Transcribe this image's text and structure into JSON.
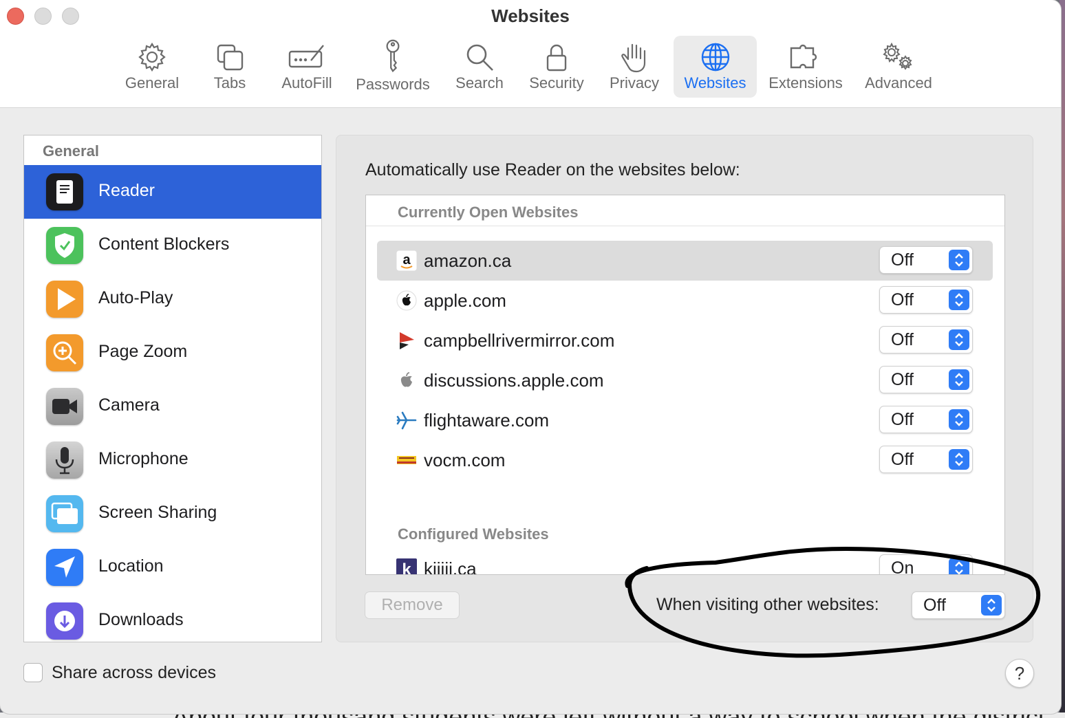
{
  "window": {
    "title": "Websites"
  },
  "background_text": "About four thousand students were left without a way to school when the district",
  "toolbar": {
    "tabs": [
      {
        "label": "General",
        "icon": "gear-icon"
      },
      {
        "label": "Tabs",
        "icon": "tabs-icon"
      },
      {
        "label": "AutoFill",
        "icon": "autofill-icon"
      },
      {
        "label": "Passwords",
        "icon": "key-icon"
      },
      {
        "label": "Search",
        "icon": "search-icon"
      },
      {
        "label": "Security",
        "icon": "lock-icon"
      },
      {
        "label": "Privacy",
        "icon": "hand-icon"
      },
      {
        "label": "Websites",
        "icon": "globe-icon",
        "selected": true
      },
      {
        "label": "Extensions",
        "icon": "puzzle-icon"
      },
      {
        "label": "Advanced",
        "icon": "gears-icon"
      }
    ]
  },
  "sidebar": {
    "header": "General",
    "items": [
      {
        "label": "Reader",
        "icon": "reader-icon",
        "selected": true
      },
      {
        "label": "Content Blockers",
        "icon": "shield-icon"
      },
      {
        "label": "Auto-Play",
        "icon": "play-icon"
      },
      {
        "label": "Page Zoom",
        "icon": "zoom-icon"
      },
      {
        "label": "Camera",
        "icon": "camera-icon"
      },
      {
        "label": "Microphone",
        "icon": "microphone-icon"
      },
      {
        "label": "Screen Sharing",
        "icon": "screen-sharing-icon"
      },
      {
        "label": "Location",
        "icon": "location-icon"
      },
      {
        "label": "Downloads",
        "icon": "download-icon"
      }
    ]
  },
  "panel": {
    "heading": "Automatically use Reader on the websites below:",
    "open_section": "Currently Open Websites",
    "open_sites": [
      {
        "domain": "amazon.ca",
        "value": "Off",
        "icon": "amazon-icon",
        "highlighted": true
      },
      {
        "domain": "apple.com",
        "value": "Off",
        "icon": "apple-icon"
      },
      {
        "domain": "campbellrivermirror.com",
        "value": "Off",
        "icon": "mirror-icon"
      },
      {
        "domain": "discussions.apple.com",
        "value": "Off",
        "icon": "apple-grey-icon"
      },
      {
        "domain": "flightaware.com",
        "value": "Off",
        "icon": "plane-icon"
      },
      {
        "domain": "vocm.com",
        "value": "Off",
        "icon": "vocm-icon"
      }
    ],
    "configured_section": "Configured Websites",
    "configured_sites": [
      {
        "domain": "kijiji.ca",
        "value": "On",
        "icon": "kijiji-icon"
      }
    ],
    "remove_label": "Remove",
    "other_label": "When visiting other websites:",
    "other_value": "Off"
  },
  "footer": {
    "share_label": "Share across devices",
    "share_checked": false,
    "help_label": "?"
  },
  "colors": {
    "accent": "#2d62d8",
    "popup_blue": "#2f7cf6",
    "annotation": "#000000"
  }
}
